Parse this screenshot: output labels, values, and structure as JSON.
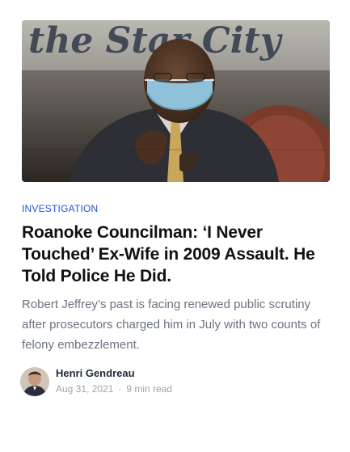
{
  "article": {
    "image_sign_text": "the Star City",
    "category": "INVESTIGATION",
    "headline": "Roanoke Councilman: ‘I Never Touched’ Ex-Wife in 2009 Assault. He Told Police He Did.",
    "dek": "Robert Jeffrey’s past is facing renewed public scrutiny after prosecutors charged him in July with two counts of felony embezzlement.",
    "author": "Henri Gendreau",
    "date": "Aug 31, 2021",
    "separator": "·",
    "read_time": "9 min read"
  },
  "colors": {
    "category": "#1a56db",
    "headline": "#111111",
    "dek": "#6b7280",
    "meta": "#9ca3af"
  }
}
